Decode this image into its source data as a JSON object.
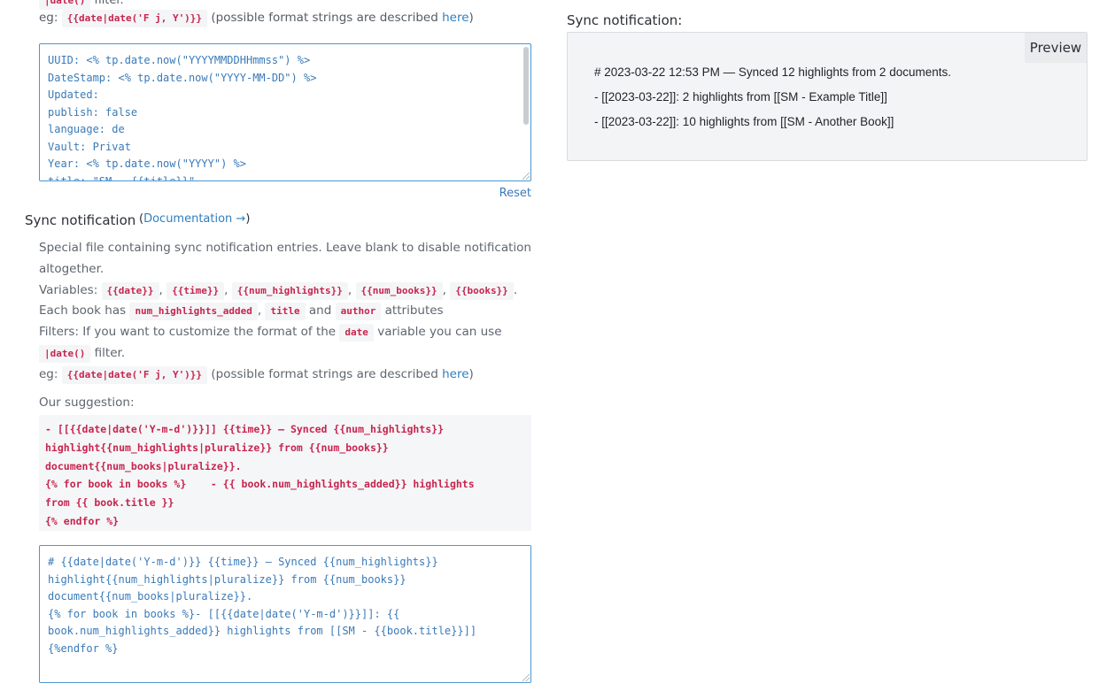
{
  "top": {
    "cut_chip": "|date()",
    "cut_text": "filter.",
    "eg_label": "eg:",
    "eg_chip": "{{date|date('F j, Y')}}",
    "eg_text_before": "(possible format strings are described ",
    "eg_link": "here",
    "eg_text_after": ")"
  },
  "template_editor": {
    "lines": [
      "UUID: <% tp.date.now(\"YYYYMMDDHHmmss\") %>",
      "DateStamp: <% tp.date.now(\"YYYY-MM-DD\") %>",
      "Updated:",
      "publish: false",
      "language: de",
      "Vault: Privat",
      "Year: <% tp.date.now(\"YYYY\") %>",
      "title: \"SM - {{title}}\""
    ]
  },
  "reset_label": "Reset",
  "section": {
    "title": "Sync notification",
    "doc_open": "(",
    "doc_link": "Documentation →",
    "doc_close": ")",
    "desc_line1": "Special file containing sync notification entries. Leave blank to disable notification altogether.",
    "variables_label": "Variables:",
    "var_date": "{{date}}",
    "var_time": "{{time}}",
    "var_num_highlights": "{{num_highlights}}",
    "var_num_books": "{{num_books}}",
    "var_books": "{{books}}",
    "each_book_text": ". Each book has",
    "attr_num_highlights_added": "num_highlights_added",
    "attr_title": "title",
    "and_text": "and",
    "attr_author": "author",
    "attributes_text": "attributes",
    "filters_text_before": "Filters: If you want to customize the format of the",
    "filters_chip": "date",
    "filters_text_after": "variable you can use",
    "filter_chip2": "|date()",
    "filter_text2": "filter.",
    "eg_label": "eg:",
    "eg_chip": "{{date|date('F j, Y')}}",
    "eg_text_before": "(possible format strings are described ",
    "eg_link": "here",
    "eg_text_after": ")"
  },
  "suggestion": {
    "label": "Our suggestion:",
    "lines": [
      "- [[{{date|date('Y-m-d')}}]] {{time}} — Synced {{num_highlights}}",
      "highlight{{num_highlights|pluralize}} from {{num_books}}",
      "document{{num_books|pluralize}}.",
      "{% for book in books %}    - {{ book.num_highlights_added}} highlights",
      "from {{ book.title }}",
      "{% endfor %}"
    ]
  },
  "notification_editor": {
    "lines": [
      "# {{date|date('Y-m-d')}} {{time}} — Synced {{num_highlights}}",
      "highlight{{num_highlights|pluralize}} from {{num_books}}",
      "document{{num_books|pluralize}}.",
      "{% for book in books %}- [[{{date|date('Y-m-d')}}]]: {{",
      "book.num_highlights_added}} highlights from [[SM - {{book.title}}]]",
      "{%endfor %}"
    ]
  },
  "preview": {
    "title": "Sync notification:",
    "tab_label": "Preview",
    "lines": [
      "# 2023-03-22 12:53 PM — Synced 12 highlights from 2 documents.",
      "- [[2023-03-22]]: 2 highlights from [[SM - Example Title]]",
      "- [[2023-03-22]]: 10 highlights from [[SM - Another Book]]"
    ]
  }
}
